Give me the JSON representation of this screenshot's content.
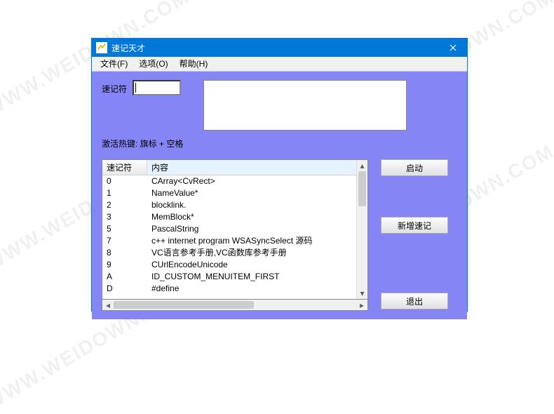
{
  "titlebar": {
    "title": "速记天才"
  },
  "menubar": {
    "file": "文件(F)",
    "options": "选项(O)",
    "help": "帮助(H)"
  },
  "form": {
    "short_label": "速记符",
    "short_value": "",
    "hotkey_label": "激活热键: 旗标 + 空格"
  },
  "list": {
    "header_col1": "速记符",
    "header_col2": "内容",
    "rows": [
      {
        "k": "0",
        "v": "CArray<CvRect>"
      },
      {
        "k": "1",
        "v": "NameValue*"
      },
      {
        "k": "2",
        "v": "blocklink."
      },
      {
        "k": "3",
        "v": "MemBlock*"
      },
      {
        "k": "5",
        "v": "PascalString"
      },
      {
        "k": "7",
        "v": "c++ internet program WSASyncSelect 源码"
      },
      {
        "k": "8",
        "v": "VC语言参考手册,VC函数库参考手册"
      },
      {
        "k": "9",
        "v": "CUrlEncodeUnicode"
      },
      {
        "k": "A",
        "v": "ID_CUSTOM_MENUITEM_FIRST"
      },
      {
        "k": "D",
        "v": "#define"
      }
    ]
  },
  "buttons": {
    "start": "启动",
    "add": "新增速记",
    "exit": "退出"
  },
  "watermark": "WWW.WEIDOWN.COM"
}
